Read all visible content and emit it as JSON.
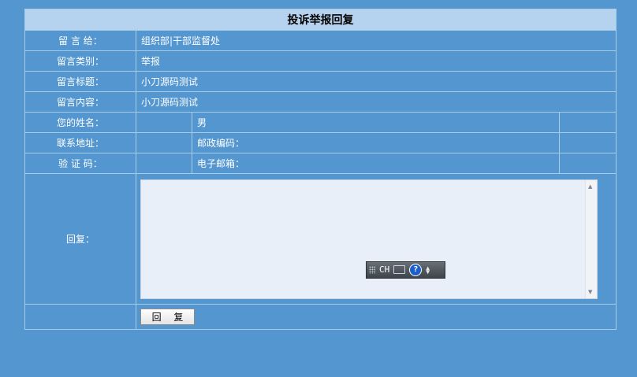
{
  "form": {
    "title": "投诉举报回复",
    "rows": {
      "recipient": {
        "label": "留 言 给：",
        "value": "组织部|干部监督处"
      },
      "category": {
        "label": "留言类别：",
        "value": "举报"
      },
      "subject": {
        "label": "留言标题：",
        "value": "小刀源码测试"
      },
      "content": {
        "label": "留言内容：",
        "value": "小刀源码测试"
      },
      "name": {
        "label": "您的姓名：",
        "value": "",
        "gender": "男"
      },
      "address": {
        "label": "联系地址：",
        "value": "",
        "postcode_label": "邮政编码：",
        "postcode_value": ""
      },
      "captcha": {
        "label": "验 证 码：",
        "value": "",
        "email_label": "电子邮箱：",
        "email_value": ""
      }
    },
    "reply": {
      "label": "回复：",
      "text": "",
      "button_label": "回 复"
    }
  },
  "ime_toolbar": {
    "lang": "CH",
    "help": "?"
  },
  "icons": [
    "scroll-up-icon",
    "scroll-down-icon",
    "ime-grip-icon",
    "keyboard-icon",
    "help-icon",
    "menu-arrow-icon"
  ]
}
